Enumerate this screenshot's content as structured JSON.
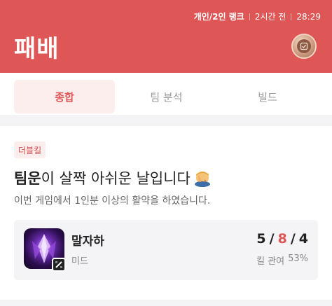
{
  "header": {
    "queue": "개인/2인 랭크",
    "time_ago": "2시간 전",
    "duration": "28:29",
    "result": "패배",
    "accent": "#de5656"
  },
  "tabs": [
    {
      "label": "종합",
      "active": true
    },
    {
      "label": "팀 분석",
      "active": false
    },
    {
      "label": "빌드",
      "active": false
    }
  ],
  "summary": {
    "tag": "더블킬",
    "headline_em": "팀운",
    "headline_rest": "이 살짝 아쉬운 날입니다",
    "emoji": "face-palm-emoji",
    "subtext": "이번 게임에서 1인분 이상의 활약을 하였습니다."
  },
  "player": {
    "name": "말자하",
    "role": "미드",
    "kills": "5",
    "deaths": "8",
    "assists": "4",
    "kda_sep": "/",
    "kill_participation_label": "킬 관여",
    "kill_participation": "53%"
  }
}
